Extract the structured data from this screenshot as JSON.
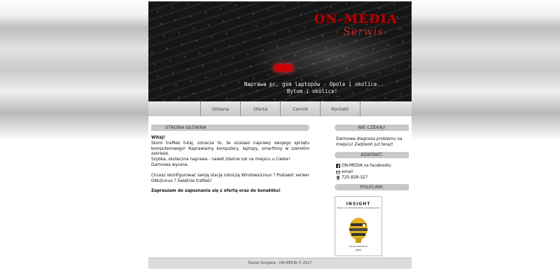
{
  "header": {
    "logo_title": "ON-MEDIA",
    "logo_subtitle": "Serwis",
    "tagline_line1": "Naprawa pc, gsm laptopów - Opole i okolice.",
    "tagline_line2": "Bytom i okolice!"
  },
  "nav": {
    "items": [
      {
        "label": "Główna"
      },
      {
        "label": "Oferta"
      },
      {
        "label": "Cennik"
      },
      {
        "label": "Kontakt"
      }
    ]
  },
  "main": {
    "section_title": "STRONA GŁÓWNA",
    "greeting": "Witaj!",
    "paragraph1": "Skoro trafiłeś tutaj, oznacza to, że szukasz naprawy swojego sprzętu komputerowego! Naprawiamy komputery, laptopy, smartfony w szerokim zakresie.",
    "line2": "Szybka, skuteczna naprawa - nawet zdalnie lub na miejscu u Ciebie!",
    "line3": "Darmowa wycena",
    "paragraph2": "Chcesz skonfigurować swoją stację roboczą Windows/Linux ? Postawić serwer GNU/Linux ? Świetnie trafiłeś!",
    "invitation": "Zapraszam do zapoznania się z ofertą oraz do konaktku!"
  },
  "sidebar": {
    "offer_title": "NIE CZEKAJ!",
    "offer_text": "Darmowa diagnoza problemu na miejscu! Zadzwoń już teraz!",
    "contact_title": "KONTAKT:",
    "contacts": {
      "facebook": {
        "label": "ON-MEDIA na facebooku",
        "icon": "facebook-icon"
      },
      "email": {
        "label": "email",
        "icon": "envelope-icon"
      },
      "phone": {
        "label": "725-828-327",
        "icon": "phone-icon"
      }
    },
    "recommend_title": "POLECAM:",
    "book": {
      "title": "INSIGHT",
      "subtitle": "BRAMA DO WEWNĘTRZNEJ DOSKONAŁOŚCI",
      "author": "ZIGGIE PRESENTS",
      "publisher": "przer"
    }
  },
  "footer": {
    "text": "Daniel Śmigiela - ON-MEDIA © 2017"
  },
  "colors": {
    "accent_red": "#bb0000",
    "section_bar": "#c8c8c8",
    "header_bg": "#111111"
  }
}
